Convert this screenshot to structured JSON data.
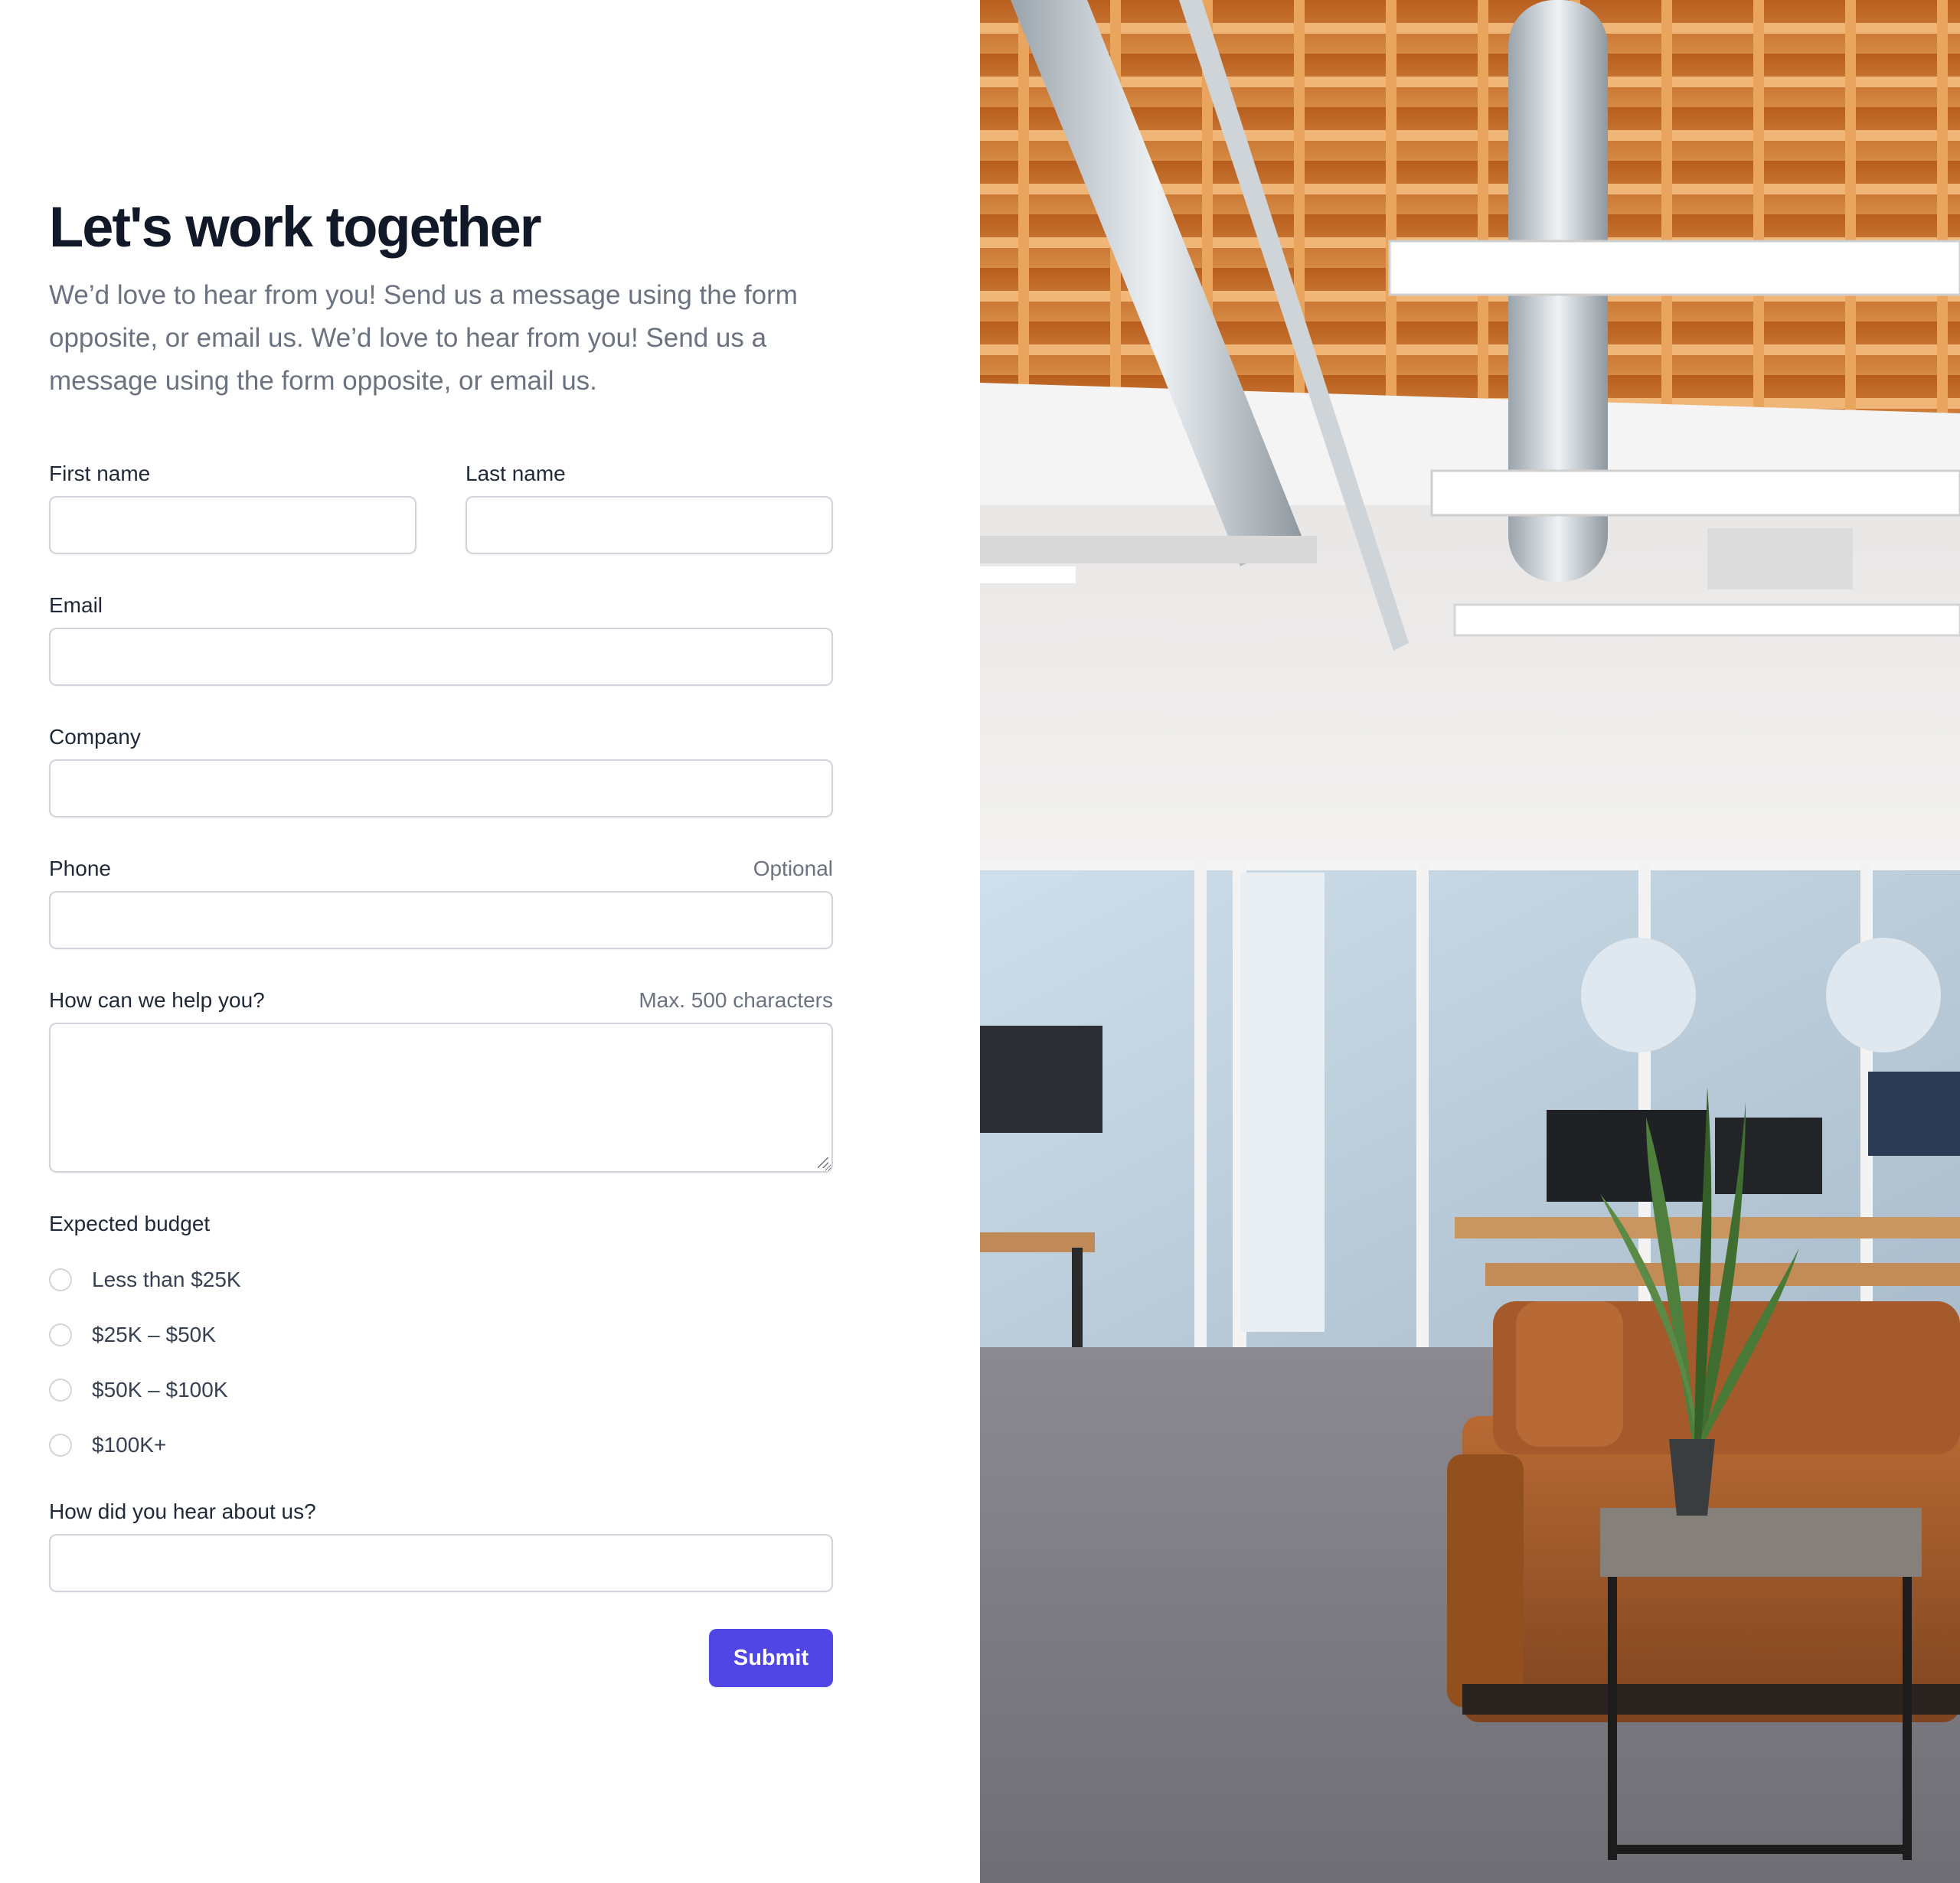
{
  "header": {
    "title": "Let's work together",
    "intro": "We’d love to hear from you! Send us a message using the form opposite, or email us. We’d love to hear from you! Send us a message using the form opposite, or email us."
  },
  "form": {
    "first_name": {
      "label": "First name",
      "value": ""
    },
    "last_name": {
      "label": "Last name",
      "value": ""
    },
    "email": {
      "label": "Email",
      "value": ""
    },
    "company": {
      "label": "Company",
      "value": ""
    },
    "phone": {
      "label": "Phone",
      "hint": "Optional",
      "value": ""
    },
    "message": {
      "label": "How can we help you?",
      "hint": "Max. 500 characters",
      "value": ""
    },
    "budget": {
      "label": "Expected budget",
      "options": [
        "Less than $25K",
        "$25K – $50K",
        "$50K – $100K",
        "$100K+"
      ],
      "selected": null
    },
    "referral": {
      "label": "How did you hear about us?",
      "value": ""
    },
    "submit_label": "Submit"
  },
  "image": {
    "subject": "office-interior-photo"
  },
  "colors": {
    "accent": "#4f46e5",
    "heading": "#111827",
    "muted": "#6b7280",
    "border": "#d1d5db"
  }
}
